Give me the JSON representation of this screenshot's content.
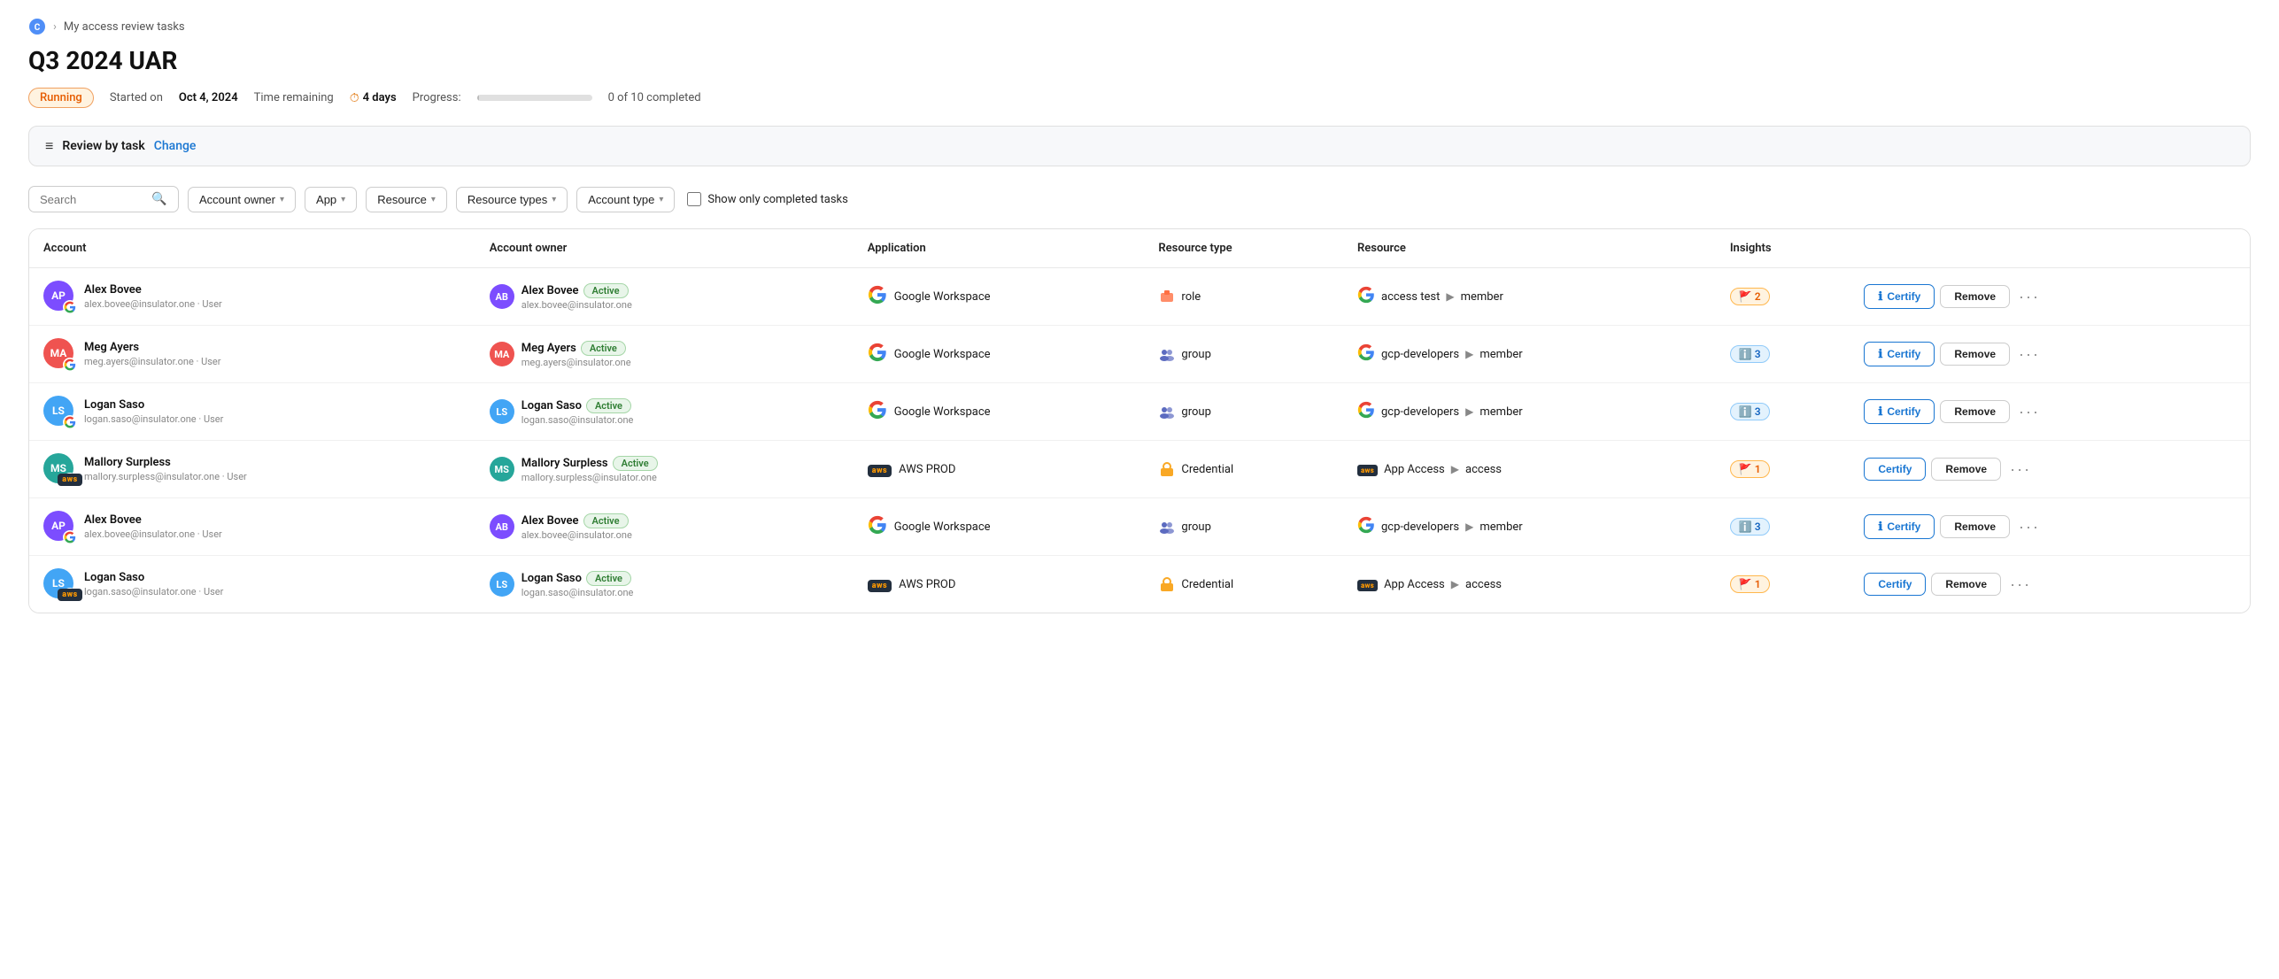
{
  "breadcrumb": {
    "home": "My access review tasks"
  },
  "page": {
    "title": "Q3 2024 UAR"
  },
  "meta": {
    "status": "Running",
    "started_label": "Started on",
    "started_value": "Oct 4, 2024",
    "time_remaining_label": "Time remaining",
    "time_remaining_value": "4 days",
    "progress_label": "Progress:",
    "progress_text": "0 of 10 completed",
    "progress_pct": 0
  },
  "review_bar": {
    "label": "Review by task",
    "change": "Change"
  },
  "filters": {
    "search_placeholder": "Search",
    "account_owner": "Account owner",
    "app": "App",
    "resource": "Resource",
    "resource_types": "Resource types",
    "account_type": "Account type",
    "show_completed": "Show only completed tasks"
  },
  "table": {
    "headers": [
      "Account",
      "Account owner",
      "Application",
      "Resource type",
      "Resource",
      "Insights",
      ""
    ],
    "rows": [
      {
        "account_initials": "AP",
        "account_av_class": "av-ap",
        "account_app_icon": "google",
        "account_name": "Alex Bovee",
        "account_email": "alex.bovee@insulator.one · User",
        "owner_initials": "AB",
        "owner_av_class": "av-ap",
        "owner_name": "Alex Bovee",
        "owner_status": "Active",
        "owner_email": "alex.bovee@insulator.one",
        "app": "Google Workspace",
        "app_type": "google",
        "resource_type_icon": "role",
        "resource_type": "role",
        "resource_app": "google",
        "resource": "access test",
        "resource_arrow": "▶",
        "resource_suffix": "member",
        "insights_type": "flag",
        "insights_count": "2",
        "certify_icon": true,
        "certify_label": "Certify",
        "remove_label": "Remove"
      },
      {
        "account_initials": "MA",
        "account_av_class": "av-ma",
        "account_app_icon": "google",
        "account_name": "Meg Ayers",
        "account_email": "meg.ayers@insulator.one · User",
        "owner_initials": "MA",
        "owner_av_class": "av-ma",
        "owner_name": "Meg Ayers",
        "owner_status": "Active",
        "owner_email": "meg.ayers@insulator.one",
        "app": "Google Workspace",
        "app_type": "google",
        "resource_type_icon": "group",
        "resource_type": "group",
        "resource_app": "google",
        "resource": "gcp-developers",
        "resource_arrow": "▶",
        "resource_suffix": "member",
        "insights_type": "info",
        "insights_count": "3",
        "certify_icon": true,
        "certify_label": "Certify",
        "remove_label": "Remove"
      },
      {
        "account_initials": "LS",
        "account_av_class": "av-ls",
        "account_app_icon": "google",
        "account_name": "Logan Saso",
        "account_email": "logan.saso@insulator.one · User",
        "owner_initials": "LS",
        "owner_av_class": "av-ls",
        "owner_name": "Logan Saso",
        "owner_status": "Active",
        "owner_email": "logan.saso@insulator.one",
        "app": "Google Workspace",
        "app_type": "google",
        "resource_type_icon": "group",
        "resource_type": "group",
        "resource_app": "google",
        "resource": "gcp-developers",
        "resource_arrow": "▶",
        "resource_suffix": "member",
        "insights_type": "info",
        "insights_count": "3",
        "certify_icon": true,
        "certify_label": "Certify",
        "remove_label": "Remove"
      },
      {
        "account_initials": "MS",
        "account_av_class": "av-ms",
        "account_app_icon": "aws",
        "account_name": "Mallory Surpless",
        "account_email": "mallory.surpless@insulator.one · User",
        "owner_initials": "MS",
        "owner_av_class": "av-ms",
        "owner_name": "Mallory Surpless",
        "owner_status": "Active",
        "owner_email": "mallory.surpless@insulator.one",
        "app": "AWS PROD",
        "app_type": "aws",
        "resource_type_icon": "credential",
        "resource_type": "Credential",
        "resource_app": "aws",
        "resource": "App Access",
        "resource_arrow": "▶",
        "resource_suffix": "access",
        "insights_type": "flag",
        "insights_count": "1",
        "certify_icon": false,
        "certify_label": "Certify",
        "remove_label": "Remove"
      },
      {
        "account_initials": "AP",
        "account_av_class": "av-ap",
        "account_app_icon": "google",
        "account_name": "Alex Bovee",
        "account_email": "alex.bovee@insulator.one · User",
        "owner_initials": "AB",
        "owner_av_class": "av-ap",
        "owner_name": "Alex Bovee",
        "owner_status": "Active",
        "owner_email": "alex.bovee@insulator.one",
        "app": "Google Workspace",
        "app_type": "google",
        "resource_type_icon": "group",
        "resource_type": "group",
        "resource_app": "google",
        "resource": "gcp-developers",
        "resource_arrow": "▶",
        "resource_suffix": "member",
        "insights_type": "info",
        "insights_count": "3",
        "certify_icon": true,
        "certify_label": "Certify",
        "remove_label": "Remove"
      },
      {
        "account_initials": "LS",
        "account_av_class": "av-ls",
        "account_app_icon": "aws",
        "account_name": "Logan Saso",
        "account_email": "logan.saso@insulator.one · User",
        "owner_initials": "LS",
        "owner_av_class": "av-ls",
        "owner_name": "Logan Saso",
        "owner_status": "Active",
        "owner_email": "logan.saso@insulator.one",
        "app": "AWS PROD",
        "app_type": "aws",
        "resource_type_icon": "credential",
        "resource_type": "Credential",
        "resource_app": "aws",
        "resource": "App Access",
        "resource_arrow": "▶",
        "resource_suffix": "access",
        "insights_type": "flag",
        "insights_count": "1",
        "certify_icon": false,
        "certify_label": "Certify",
        "remove_label": "Remove"
      }
    ]
  }
}
